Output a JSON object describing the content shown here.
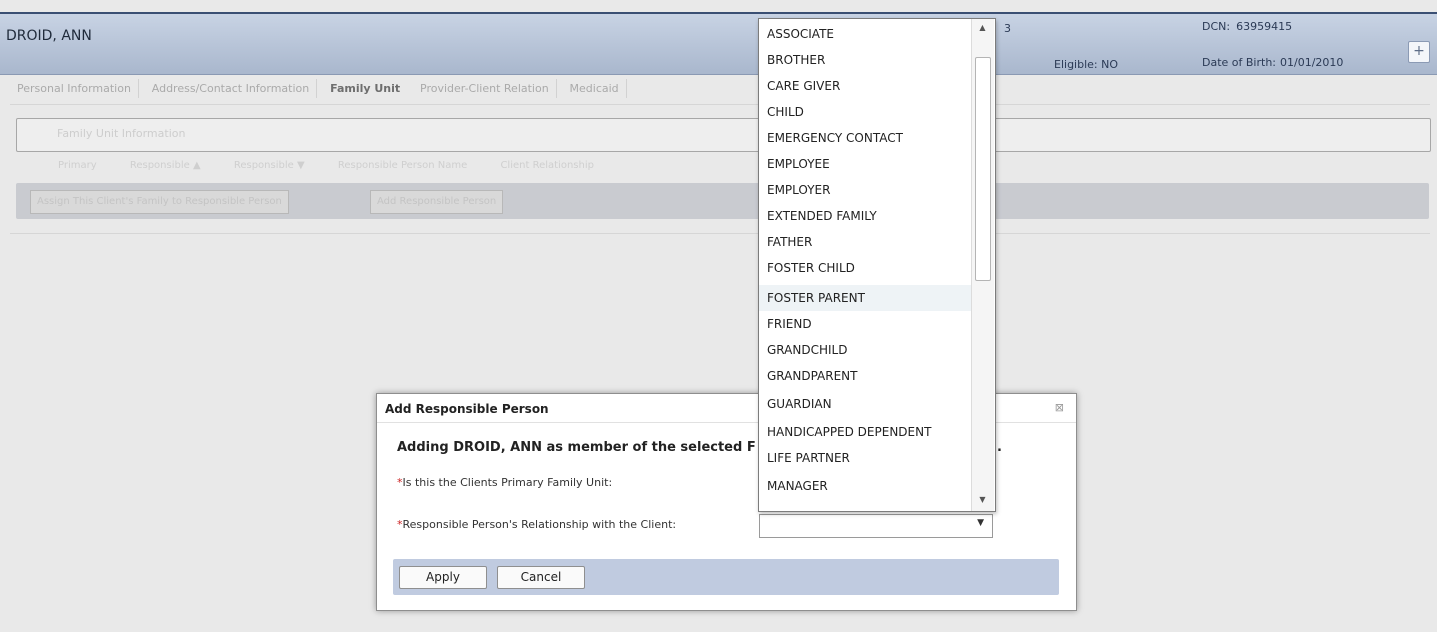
{
  "header": {
    "client_name": "DROID, ANN",
    "digit_fragment": "3",
    "eligible_label": "Eligible:",
    "eligible_value": "NO",
    "dcn_label": "DCN:",
    "dcn_value": "63959415",
    "dob_label": "Date of Birth:",
    "dob_value": "01/01/2010",
    "expand_label": "+"
  },
  "tabs": [
    {
      "label": "Personal Information"
    },
    {
      "label": "Address/Contact Information"
    },
    {
      "label": "Family Unit"
    },
    {
      "label": "Provider-Client Relation"
    },
    {
      "label": "Medicaid"
    }
  ],
  "background": {
    "family_unit_panel": "Family Unit Information",
    "ghost_row": [
      "Primary",
      "Responsible ▲",
      "Responsible ▼",
      "Responsible Person Name",
      "Client Relationship"
    ],
    "assign_button": "Assign This Client's Family to Responsible Person",
    "add_button": "Add Responsible Person"
  },
  "modal": {
    "title": "Add Responsible Person",
    "close_label": "⊠",
    "heading_start": "Adding DROID, ANN as member of the selected F",
    "heading_end": ".",
    "req_marker": "*",
    "primary_label": "Is this the Clients Primary Family Unit:",
    "relationship_label": "Responsible Person's Relationship with the Client:",
    "relationship_value": "",
    "apply_label": "Apply",
    "cancel_label": "Cancel"
  },
  "dropdown": {
    "options": [
      "ASSOCIATE",
      "BROTHER",
      "CARE GIVER",
      "CHILD",
      "EMERGENCY CONTACT",
      "EMPLOYEE",
      "EMPLOYER",
      "EXTENDED FAMILY",
      "FATHER",
      "FOSTER CHILD",
      "FOSTER PARENT",
      "FRIEND",
      "GRANDCHILD",
      "GRANDPARENT",
      "GUARDIAN",
      "HANDICAPPED DEPENDENT",
      "LIFE PARTNER",
      "MANAGER"
    ],
    "hovered": "FOSTER PARENT",
    "scroll_up": "▲",
    "scroll_down": "▼"
  },
  "colors": {
    "header_bg": "#a9b7cd",
    "header_border": "#3a4f73",
    "button_band": "#c0cbe0",
    "required_mark": "#cc2222",
    "hover_option": "#eef3f6"
  }
}
